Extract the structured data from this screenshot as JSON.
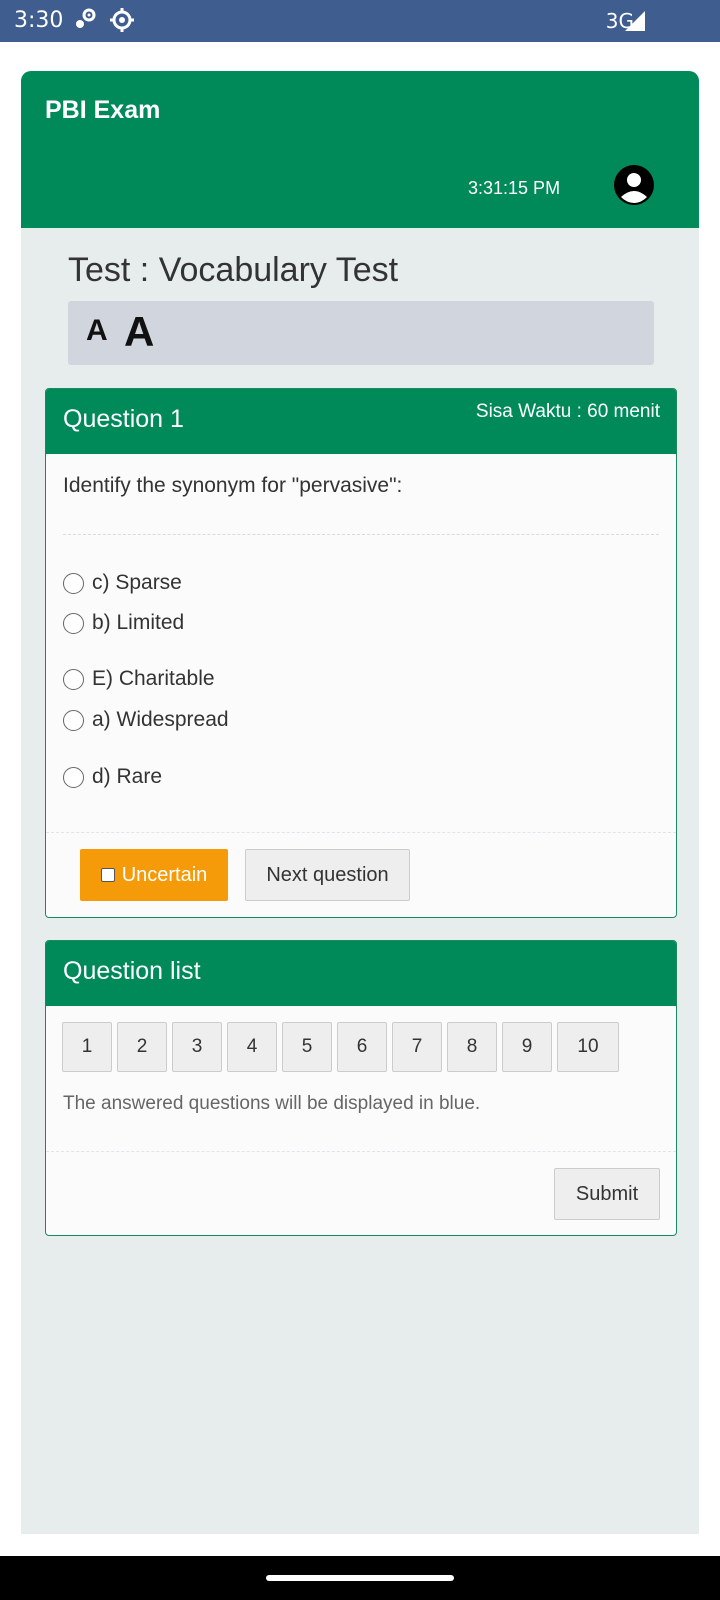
{
  "status_bar": {
    "time": "3:30",
    "network": "3G",
    "icons": [
      "settings-gear-cluster-icon",
      "gear-icon",
      "signal-icon"
    ]
  },
  "app": {
    "brand": "PBI Exam",
    "clock": "3:31:15 PM",
    "avatar_icon": "account-circle-icon",
    "accent_color": "#008a5a"
  },
  "test": {
    "title": "Test : Vocabulary Test",
    "font_small_label": "A",
    "font_large_label": "A"
  },
  "question": {
    "header": "Question 1",
    "remaining_time": "Sisa Waktu : 60 menit",
    "text": "Identify the synonym for \"pervasive\":",
    "options": [
      "c) Sparse",
      "b) Limited",
      "E) Charitable",
      "a) Widespread",
      "d) Rare"
    ],
    "uncertain_label": "Uncertain",
    "next_label": "Next question",
    "uncertain_color": "#f59b0a"
  },
  "question_list": {
    "header": "Question list",
    "numbers": [
      "1",
      "2",
      "3",
      "4",
      "5",
      "6",
      "7",
      "8",
      "9",
      "10"
    ],
    "note": "The answered questions will be displayed in blue.",
    "submit_label": "Submit"
  }
}
